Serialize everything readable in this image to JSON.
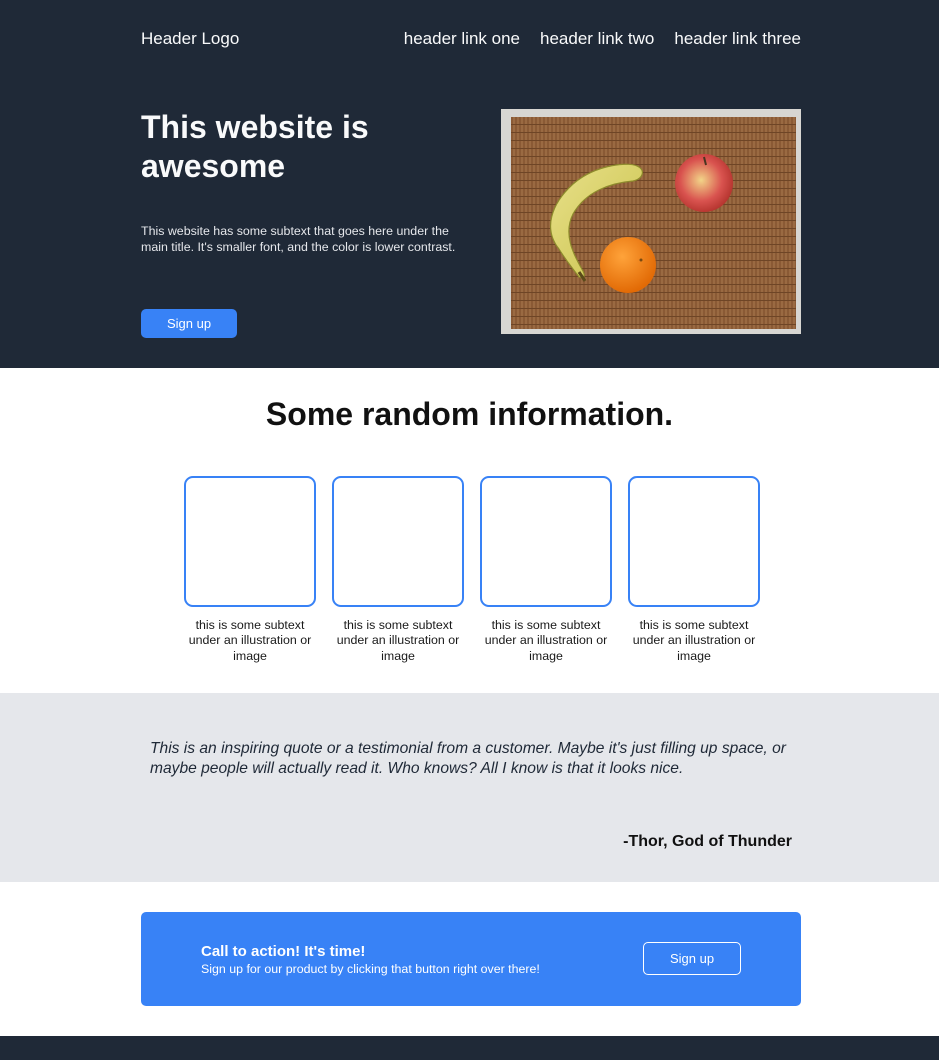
{
  "header": {
    "logo": "Header Logo",
    "links": [
      "header link one",
      "header link two",
      "header link three"
    ]
  },
  "hero": {
    "title": "This website is awesome",
    "subtext": "This website has some subtext that goes here under the main title. It's smaller font, and the color is lower contrast.",
    "button_label": "Sign up",
    "image_icon": "fruit-photo"
  },
  "info": {
    "title": "Some random information.",
    "cards": [
      {
        "text": "this is some subtext under an illustration or image"
      },
      {
        "text": "this is some subtext under an illustration or image"
      },
      {
        "text": "this is some subtext under an illustration or image"
      },
      {
        "text": "this is some subtext under an illustration or image"
      }
    ]
  },
  "quote": {
    "text": "This is an inspiring quote or a testimonial from a customer. Maybe it's just filling up space, or maybe people will actually read it. Who knows? All I know is that it looks nice.",
    "author": "-Thor, God of Thunder"
  },
  "cta": {
    "title": "Call to action! It's time!",
    "subtext": "Sign up for our product by clicking that button right over there!",
    "button_label": "Sign up"
  },
  "colors": {
    "dark_bg": "#1f2937",
    "accent": "#3882f6",
    "quote_bg": "#e5e7eb"
  }
}
